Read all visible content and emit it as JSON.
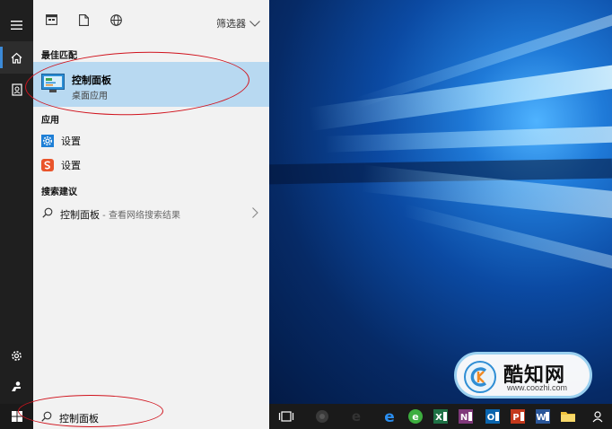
{
  "panel": {
    "filter_label": "筛选器",
    "best_match": {
      "heading": "最佳匹配",
      "title": "控制面板",
      "subtitle": "桌面应用"
    },
    "apps": {
      "heading": "应用",
      "items": [
        {
          "label": "设置",
          "icon": "gear-blue-icon"
        },
        {
          "label": "设置",
          "icon": "settings-red-icon"
        }
      ]
    },
    "suggestions": {
      "heading": "搜索建议",
      "query": "控制面板",
      "suffix": " - 查看网络搜索结果"
    }
  },
  "taskbar": {
    "search_value": "控制面板"
  },
  "watermark": {
    "brand": "酷知网",
    "url": "www.coozhi.com"
  },
  "colors": {
    "selected_row": "#b8d9f1",
    "rail": "#1f1f1f",
    "accent": "#3b8ad8",
    "annotation": "#d0131d"
  }
}
